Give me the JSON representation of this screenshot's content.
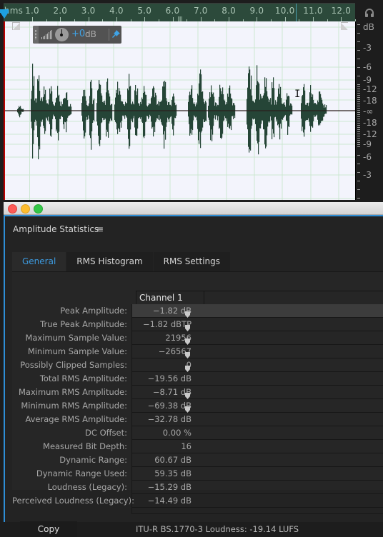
{
  "editor": {
    "ruler": {
      "unit_label": "hms",
      "ticks": [
        "1.0",
        "2.0",
        "3.0",
        "4.0",
        "5.0",
        "6.0",
        "7.0",
        "8.0",
        "9.0",
        "10.0",
        "11.0",
        "12.0"
      ]
    },
    "db_scale": [
      "dB",
      "-3",
      "-6",
      "-9",
      "-12",
      "-18",
      "-∞",
      "-18",
      "-12",
      "-9",
      "-6",
      "-3"
    ],
    "hud": {
      "gain_value": "+0",
      "gain_unit": "dB"
    },
    "colors": {
      "ruler_bg": "#2c4a3b",
      "waveform": "#254537",
      "wave_bg": "#f3f4fc",
      "grid": "#cde7d2",
      "accent": "#1ea0e0"
    }
  },
  "dialog": {
    "title": "Amplitude Statistics",
    "menu_icon": "≡",
    "tabs": [
      {
        "label": "General",
        "active": true
      },
      {
        "label": "RMS Histogram",
        "active": false
      },
      {
        "label": "RMS Settings",
        "active": false
      }
    ],
    "column_header": "Channel 1",
    "rows": [
      {
        "label": "Peak Amplitude:",
        "value": "−1.82 dB",
        "locate": true,
        "selected": true
      },
      {
        "label": "True Peak Amplitude:",
        "value": "−1.82 dBTP",
        "locate": true
      },
      {
        "label": "Maximum Sample Value:",
        "value": "21956",
        "locate": true
      },
      {
        "label": "Minimum Sample Value:",
        "value": "−26567",
        "locate": true
      },
      {
        "label": "Possibly Clipped Samples:",
        "value": "0",
        "locate": true
      },
      {
        "label": "Total RMS Amplitude:",
        "value": "−19.56 dB",
        "locate": false
      },
      {
        "label": "Maximum RMS Amplitude:",
        "value": "−8.71 dB",
        "locate": true
      },
      {
        "label": "Minimum RMS Amplitude:",
        "value": "−69.38 dB",
        "locate": true
      },
      {
        "label": "Average RMS Amplitude:",
        "value": "−32.78 dB",
        "locate": false
      },
      {
        "label": "DC Offset:",
        "value": "0.00 %",
        "locate": false
      },
      {
        "label": "Measured Bit Depth:",
        "value": "16",
        "locate": false
      },
      {
        "label": "Dynamic Range:",
        "value": "60.67 dB",
        "locate": false
      },
      {
        "label": "Dynamic Range Used:",
        "value": "59.35 dB",
        "locate": false
      },
      {
        "label": "Loudness (Legacy):",
        "value": "−15.29 dB",
        "locate": false
      },
      {
        "label": "Perceived Loudness (Legacy):",
        "value": "−14.49 dB",
        "locate": false
      }
    ],
    "copy_label": "Copy",
    "loudness_footer": "ITU-R BS.1770-3 Loudness: -19.14 LUFS"
  }
}
